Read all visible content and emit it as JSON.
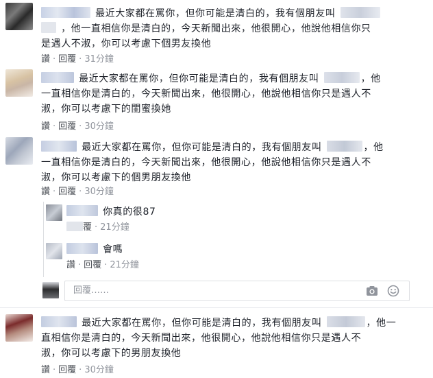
{
  "colors": {
    "link": "#4b4f56",
    "meta": "#90949c",
    "text": "#1d2129",
    "border": "#dddfe2"
  },
  "actions": {
    "like": "讚",
    "reply": "回覆",
    "separator": "·"
  },
  "comments": [
    {
      "lines": [
        "最近大家都在罵你，但你可能是清白的，我有個朋友叫",
        "，他一直相信你是清白的，今天新聞出來，他很開心，他說他相信你只",
        "是遇人不淑，你可以考慮下個男友換他"
      ],
      "time": "31分鐘"
    },
    {
      "lines": [
        "最近大家都在罵你，但你可能是清白的，我有個朋友叫",
        "，他",
        "一直相信你是清白的，今天新聞出來，他很開心，他說他相信你只是遇人不",
        "淑，你可以考慮下的閨蜜換她"
      ],
      "time": "30分鐘"
    },
    {
      "lines": [
        "最近大家都在罵你，但你可能是清白的，我有個朋友叫",
        "，他",
        "一直相信你是清白的，今天新聞出來，他很開心，他說他相信你只是遇人不",
        "淑，你可以考慮下的個男朋友換他"
      ],
      "time": "30分鐘"
    },
    {
      "lines": [
        "最近大家都在罵你，但你可能是清白的，我有個朋友叫",
        "，他一",
        "直相信你是清白的，今天新聞出來，他很開心，他說他相信你只是遇人不",
        "淑，你可以考慮下的男朋友換他"
      ],
      "time": "30分鐘"
    }
  ],
  "replies": [
    {
      "text": "你真的很87",
      "like_tail": "覆",
      "time": "21分鐘"
    },
    {
      "text": "會嗎",
      "time": "21分鐘"
    }
  ],
  "reply_box": {
    "placeholder": "回覆……"
  },
  "icons": {
    "camera": "camera-icon",
    "emoji": "emoji-icon"
  }
}
